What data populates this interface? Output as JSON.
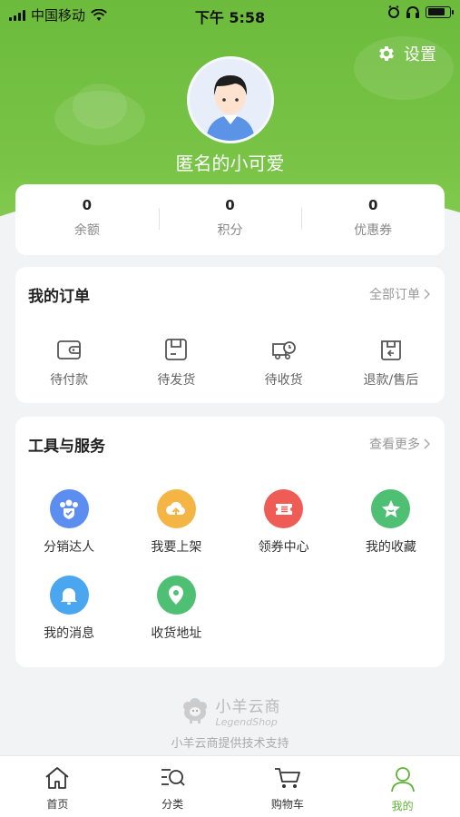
{
  "status_bar": {
    "carrier": "中国移动",
    "time": "下午 5:58"
  },
  "header": {
    "settings_label": "设置",
    "username": "匿名的小可爱"
  },
  "stats": [
    {
      "value": "0",
      "label": "余额"
    },
    {
      "value": "0",
      "label": "积分"
    },
    {
      "value": "0",
      "label": "优惠券"
    }
  ],
  "orders": {
    "title": "我的订单",
    "more": "全部订单",
    "items": [
      {
        "label": "待付款",
        "icon": "wallet-icon"
      },
      {
        "label": "待发货",
        "icon": "box-icon"
      },
      {
        "label": "待收货",
        "icon": "delivery-truck-icon"
      },
      {
        "label": "退款/售后",
        "icon": "refund-box-icon"
      }
    ]
  },
  "tools": {
    "title": "工具与服务",
    "more": "查看更多",
    "items": [
      {
        "label": "分销达人",
        "icon": "group-shield-icon",
        "color": "#5b8ef0"
      },
      {
        "label": "我要上架",
        "icon": "cloud-upload-icon",
        "color": "#f5b544"
      },
      {
        "label": "领券中心",
        "icon": "coupon-icon",
        "color": "#ee5c55"
      },
      {
        "label": "我的收藏",
        "icon": "star-icon",
        "color": "#4fbf74"
      },
      {
        "label": "我的消息",
        "icon": "bell-icon",
        "color": "#4aa6ef"
      },
      {
        "label": "收货地址",
        "icon": "location-pin-icon",
        "color": "#4fbf74"
      }
    ]
  },
  "footer": {
    "brand_cn": "小羊云商",
    "brand_en": "LegendShop",
    "support": "小羊云商提供技术支持"
  },
  "tabbar": [
    {
      "label": "首页",
      "icon": "home-icon"
    },
    {
      "label": "分类",
      "icon": "category-search-icon"
    },
    {
      "label": "购物车",
      "icon": "cart-icon"
    },
    {
      "label": "我的",
      "icon": "user-icon",
      "active": true
    }
  ],
  "colors": {
    "brand_green": "#6cbb3c",
    "active_tab": "#5fb236"
  }
}
